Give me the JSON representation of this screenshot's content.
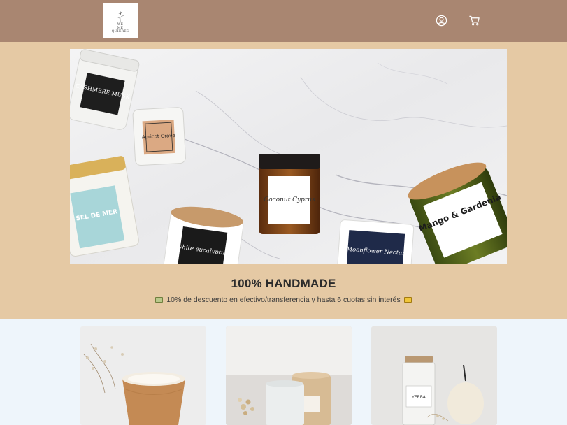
{
  "header": {
    "logo_text": [
      "WE",
      "ME",
      "QUIERES"
    ],
    "icons": {
      "account": "user-circle-icon",
      "cart": "shopping-cart-icon"
    },
    "colors": {
      "background": "#a98671"
    }
  },
  "hero": {
    "banner_label": "candles product banner",
    "candle_labels": [
      "CASHMERE MUSK",
      "Apricot Grove",
      "Coconut Cyprus",
      "Mango & Gardenia",
      "white eucalyptus",
      "Moonflower Nectar",
      "SEL DE MER"
    ],
    "headline": "100% HANDMADE",
    "promo_text": "10% de descuento en efectivo/transferencia y hasta 6 cuotas sin interés",
    "colors": {
      "background": "#e5c9a4"
    }
  },
  "products": {
    "items": [
      {
        "image": "wooden candle with dried flowers"
      },
      {
        "image": "white ceramic candle with kraft box"
      },
      {
        "image": "YERBA glass jar candle with gourd",
        "label": "YERBA"
      }
    ],
    "colors": {
      "background": "#eef5fb"
    }
  }
}
